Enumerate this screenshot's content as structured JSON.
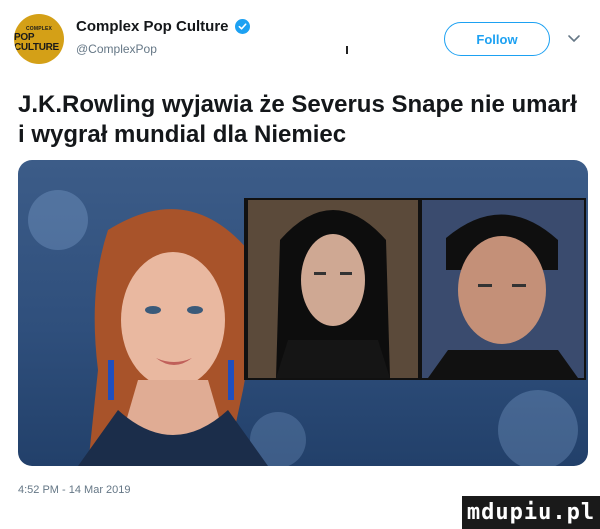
{
  "account": {
    "avatar_top_text": "COMPLEX",
    "avatar_main_text": "POP CULTURE",
    "display_name": "Complex Pop Culture",
    "handle": "@ComplexPop",
    "verified": true
  },
  "actions": {
    "follow_label": "Follow",
    "more_icon": "chevron-down-icon"
  },
  "tweet": {
    "text": "J.K.Rowling wyjawia że Severus Snape nie umarł i wygrał mundial dla Niemiec",
    "timestamp": "4:52 PM - 14 Mar 2019"
  },
  "media": {
    "description_icon": "photo-collage"
  },
  "watermark": {
    "text": "mdupiu.pl"
  },
  "colors": {
    "brand_blue": "#1da1f2",
    "avatar_gold": "#d4a017",
    "text_primary": "#14171a",
    "text_secondary": "#657786"
  }
}
